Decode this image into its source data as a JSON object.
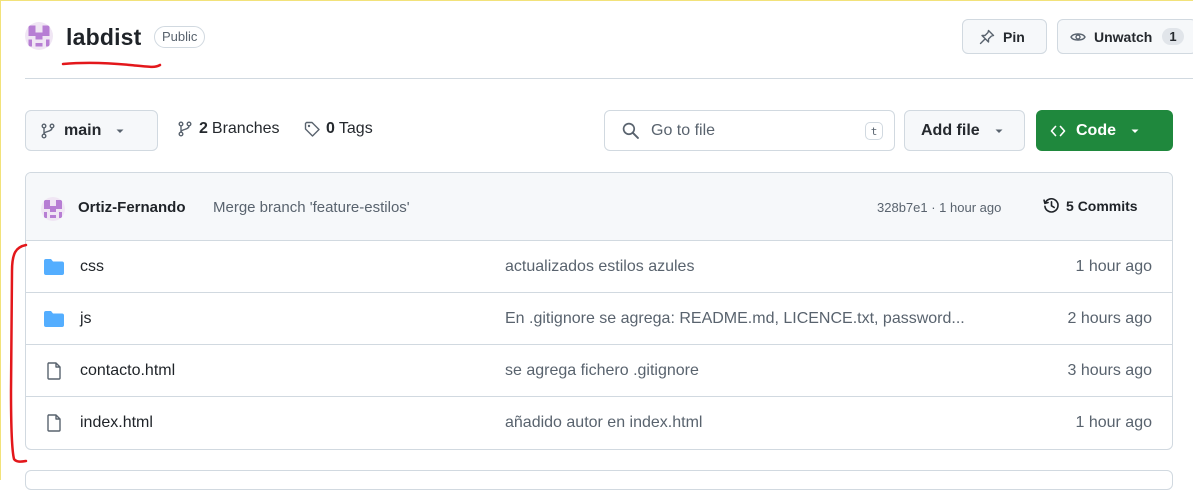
{
  "repo": {
    "name": "labdist",
    "visibility": "Public",
    "pin_label": "Pin",
    "unwatch_label": "Unwatch",
    "watch_count": "1"
  },
  "toolbar": {
    "branch": "main",
    "branches_count": "2",
    "branches_label": "Branches",
    "tags_count": "0",
    "tags_label": "Tags",
    "search_placeholder": "Go to file",
    "search_shortcut": "t",
    "add_file_label": "Add file",
    "code_label": "Code"
  },
  "latest_commit": {
    "author": "Ortiz-Fernando",
    "message": "Merge branch 'feature-estilos'",
    "meta": "328b7e1 · 1 hour ago",
    "commits_count": "5",
    "commits_label": "Commits"
  },
  "files": [
    {
      "name": "css",
      "type": "folder",
      "message": "actualizados estilos azules",
      "date": "1 hour ago"
    },
    {
      "name": "js",
      "type": "folder",
      "message": "En .gitignore se agrega: README.md, LICENCE.txt, password...",
      "date": "2 hours ago"
    },
    {
      "name": "contacto.html",
      "type": "file",
      "message": "se agrega fichero .gitignore",
      "date": "3 hours ago"
    },
    {
      "name": "index.html",
      "type": "file",
      "message": "añadido autor en index.html",
      "date": "1 hour ago"
    }
  ],
  "colors": {
    "accent_green": "#1f883d",
    "folder_blue": "#54aeff",
    "annotation_red": "#e3171b"
  }
}
